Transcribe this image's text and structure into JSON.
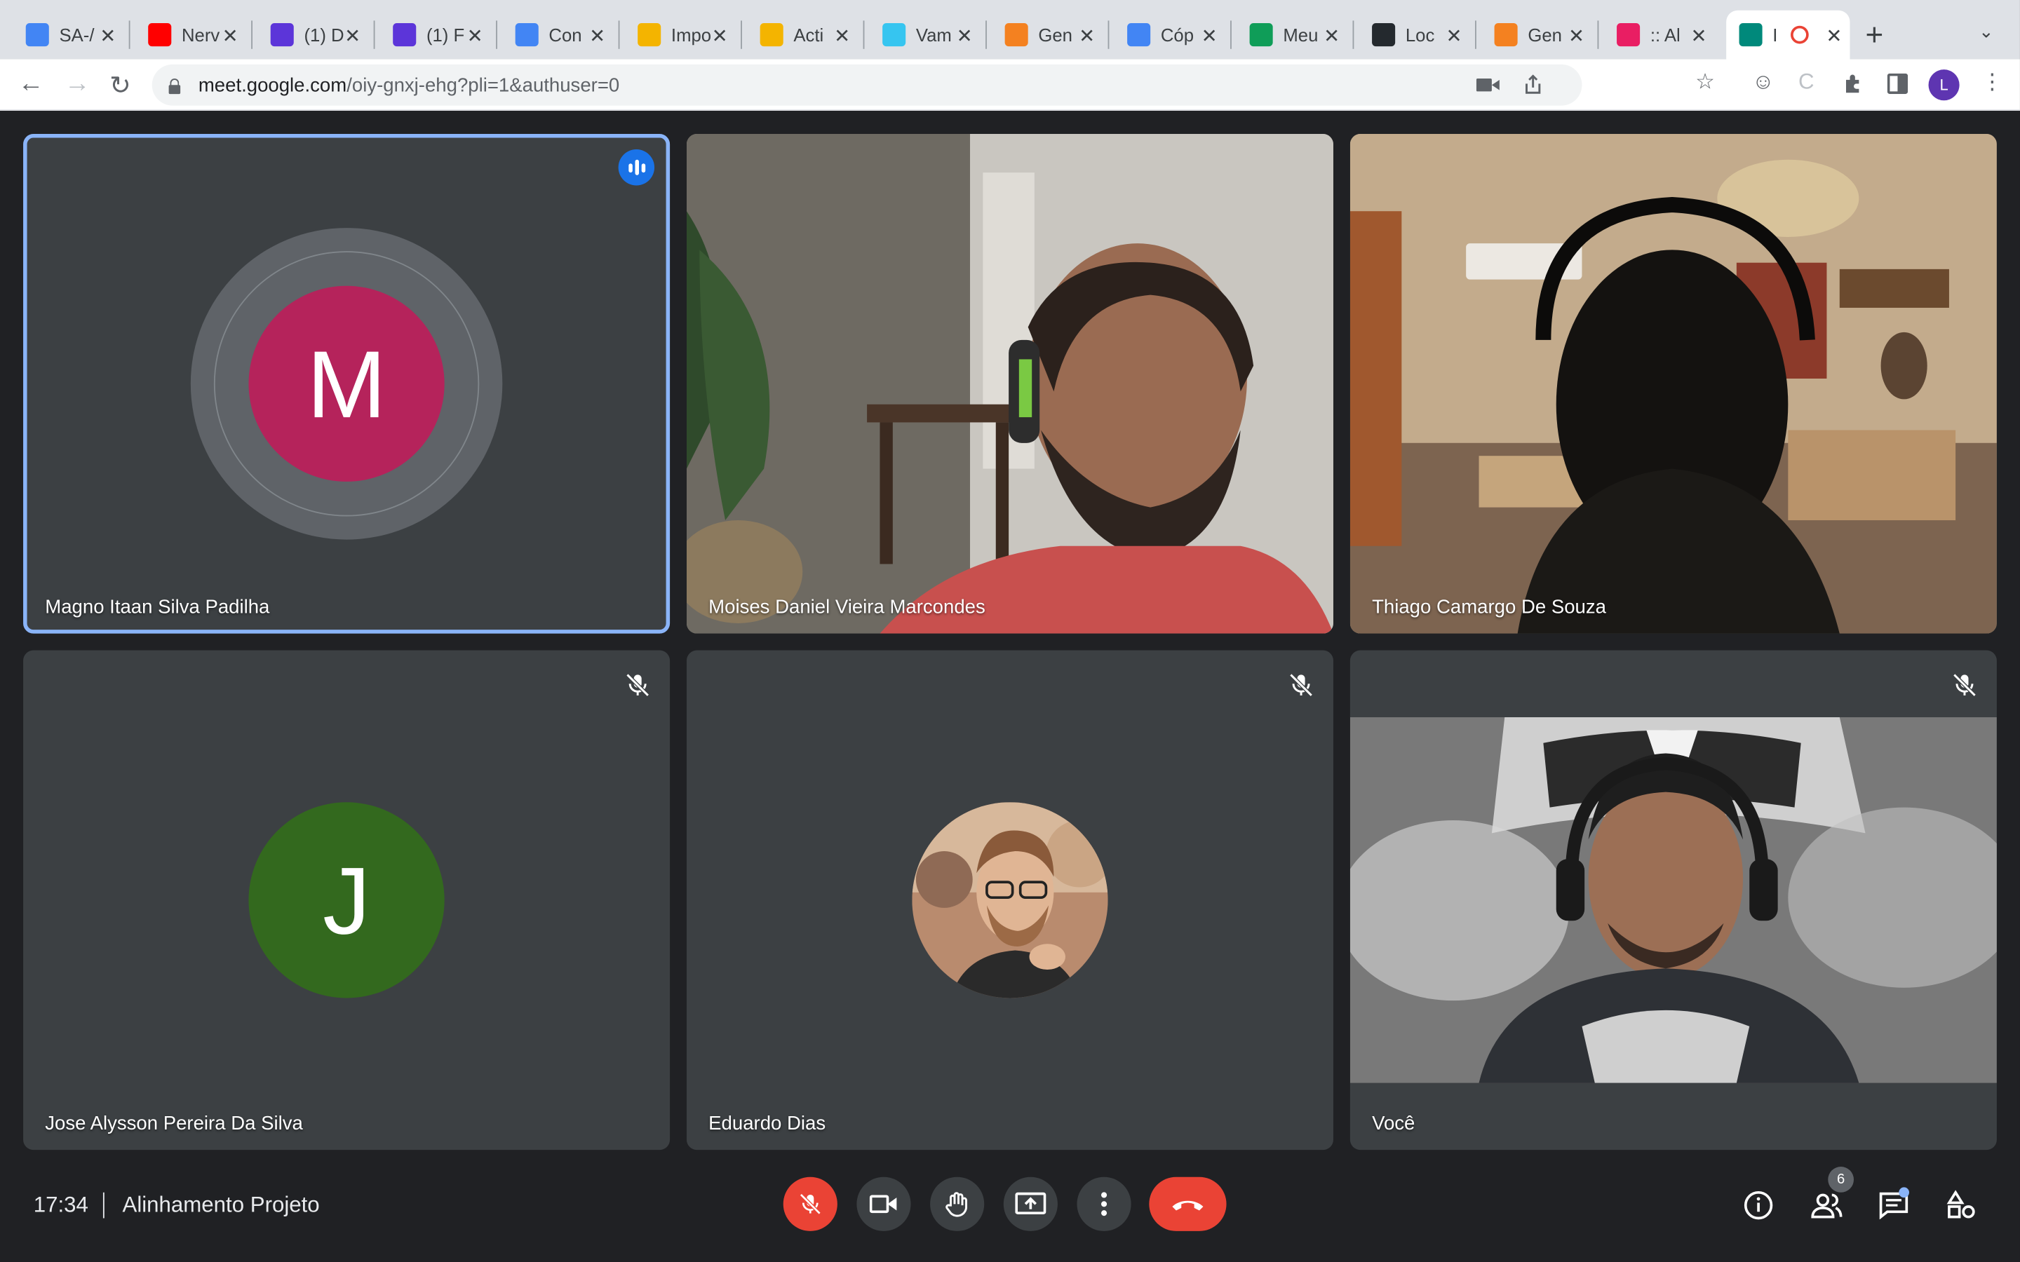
{
  "browser": {
    "tabs": [
      {
        "label": "SA-/",
        "favicon": "docs-icon",
        "color": "#4285f4"
      },
      {
        "label": "Nerv",
        "favicon": "youtube-icon",
        "color": "#ff0000"
      },
      {
        "label": "(1) D",
        "favicon": "app-icon",
        "color": "#5c35d9"
      },
      {
        "label": "(1) F",
        "favicon": "app-icon",
        "color": "#5c35d9"
      },
      {
        "label": "Con",
        "favicon": "google-icon",
        "color": "#4285f4"
      },
      {
        "label": "Impo",
        "favicon": "emoji-icon",
        "color": "#f4b400"
      },
      {
        "label": "Acti",
        "favicon": "emoji-icon",
        "color": "#f4b400"
      },
      {
        "label": "Vam",
        "favicon": "slack-icon",
        "color": "#36c5f0"
      },
      {
        "label": "Gen",
        "favicon": "cloud-icon",
        "color": "#f48120"
      },
      {
        "label": "Cóp",
        "favicon": "docs-icon",
        "color": "#4285f4"
      },
      {
        "label": "Meu",
        "favicon": "drive-icon",
        "color": "#0f9d58"
      },
      {
        "label": "Loc",
        "favicon": "github-icon",
        "color": "#24292e"
      },
      {
        "label": "Gen",
        "favicon": "cloud-icon",
        "color": "#f48120"
      },
      {
        "label": ":: Al",
        "favicon": "app-icon",
        "color": "#e91e63"
      },
      {
        "label": "I",
        "favicon": "meet-icon",
        "color": "#00897b",
        "active": true
      }
    ],
    "url_host": "meet.google.com",
    "url_path": "/oiy-gnxj-ehg?pli=1&authuser=0",
    "profile_initial": "L"
  },
  "meet": {
    "participants": [
      {
        "name": "Magno Itaan Silva Padilha",
        "type": "avatar",
        "initial": "M",
        "avatar_color": "#b5235b",
        "speaking": true
      },
      {
        "name": "Moises Daniel Vieira Marcondes",
        "type": "video"
      },
      {
        "name": "Thiago Camargo De Souza",
        "type": "video"
      },
      {
        "name": "Jose Alysson Pereira Da Silva",
        "type": "avatar",
        "initial": "J",
        "avatar_color": "#33691e",
        "muted": true
      },
      {
        "name": "Eduardo Dias",
        "type": "photo",
        "muted": true
      },
      {
        "name": "Você",
        "type": "video",
        "muted": true
      }
    ],
    "time": "17:34",
    "meeting_title": "Alinhamento Projeto",
    "participant_count": "6"
  },
  "colors": {
    "background": "#202124",
    "tile": "#3c4043",
    "speaking_outline": "#8ab4f8",
    "hangup": "#ea4335"
  }
}
